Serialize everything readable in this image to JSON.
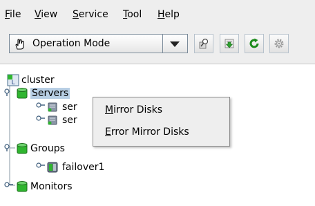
{
  "menubar": {
    "items": [
      {
        "mnemonic": "F",
        "rest": "ile"
      },
      {
        "mnemonic": "V",
        "rest": "iew"
      },
      {
        "mnemonic": "S",
        "rest": "ervice"
      },
      {
        "mnemonic": "T",
        "rest": "ool"
      },
      {
        "mnemonic": "H",
        "rest": "elp"
      }
    ]
  },
  "toolbar": {
    "mode_value": "Operation Mode",
    "buttons": [
      "search-config-icon",
      "download-icon",
      "refresh-icon",
      "settings-icon"
    ]
  },
  "tree": {
    "root": "cluster",
    "servers": "Servers",
    "server_children": [
      "ser",
      "ser"
    ],
    "groups": "Groups",
    "group_children": [
      "failover1"
    ],
    "monitors": "Monitors"
  },
  "context_menu": {
    "items": [
      {
        "mnemonic": "M",
        "rest": "irror Disks"
      },
      {
        "mnemonic": "E",
        "rest": "rror Mirror Disks"
      }
    ]
  },
  "colors": {
    "selection": "#b8cfe5",
    "toolbar_bg": "#eeeeee",
    "server_green": "#2fb52f"
  }
}
